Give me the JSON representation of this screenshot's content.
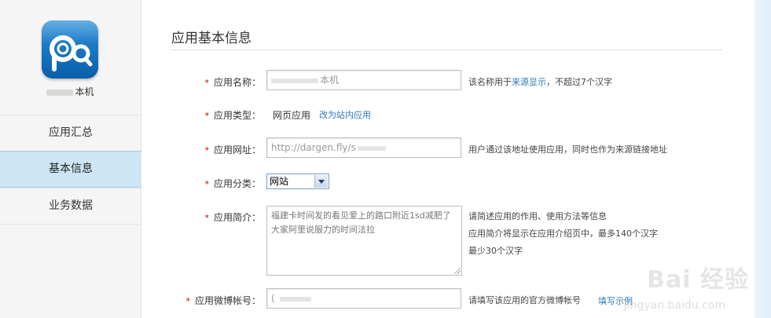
{
  "sidebar": {
    "app_name": "本机",
    "nav": [
      {
        "label": "应用汇总"
      },
      {
        "label": "基本信息"
      },
      {
        "label": "业务数据"
      }
    ]
  },
  "main": {
    "title": "应用基本信息",
    "fields": {
      "name": {
        "label": "应用名称：",
        "value": "本机",
        "hint_prefix": "该名称用于",
        "hint_link": "来源显示",
        "hint_suffix": "，不超过7个汉字"
      },
      "type": {
        "label": "应用类型：",
        "value": "网页应用",
        "action": "改为站内应用"
      },
      "url": {
        "label": "应用网址：",
        "value": "http://dargen.fly/s",
        "hint": "用户通过该地址使用应用，同时也作为来源链接地址"
      },
      "category": {
        "label": "应用分类：",
        "value": "网站"
      },
      "description": {
        "label": "应用简介：",
        "value": "福建卡时间发的看见爱上的路口附近1sd减肥了大家阿里说服力的时间法拉",
        "hints": [
          "请简述应用的作用、使用方法等信息",
          "应用简介将显示在应用介绍页中，最多140个汉字",
          "最少30个汉字"
        ]
      },
      "weibo": {
        "label": "应用微博帐号：",
        "value": "(",
        "hint": "请填写该应用的官方微博帐号",
        "link": "填写示例"
      }
    }
  },
  "watermark": {
    "brand": "Bai 经验",
    "url": "jingyan.baidu.com"
  },
  "colors": {
    "accent_link": "#2b7bb9",
    "nav_active_bg": "#cde6f6",
    "required_star": "#cc0000",
    "logo_blue": "#1f7fcf"
  }
}
